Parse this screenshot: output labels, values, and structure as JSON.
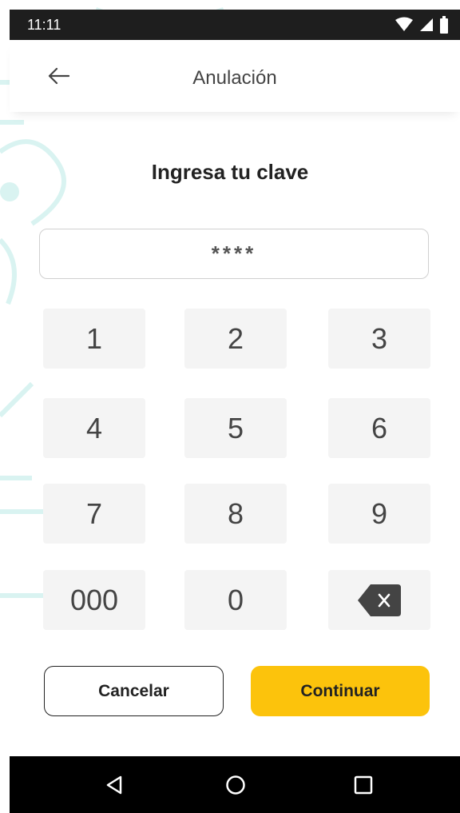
{
  "status_bar": {
    "time": "11:11",
    "icons": [
      "wifi-icon",
      "signal-icon",
      "battery-icon"
    ]
  },
  "app_bar": {
    "title": "Anulación",
    "back_icon": "arrow-left-icon"
  },
  "heading": "Ingresa tu clave",
  "pin_field": {
    "value": "****"
  },
  "keypad": {
    "keys": [
      "1",
      "2",
      "3",
      "4",
      "5",
      "6",
      "7",
      "8",
      "9",
      "000",
      "0"
    ],
    "delete_icon": "backspace-icon"
  },
  "actions": {
    "cancel_label": "Cancelar",
    "continue_label": "Continuar"
  },
  "nav_bar": {
    "icons": [
      "back-triangle-icon",
      "home-circle-icon",
      "recents-square-icon"
    ]
  },
  "colors": {
    "accent": "#fcc30c",
    "key_bg": "#f4f4f4",
    "status_bar": "#1e1e1e",
    "nav_bar": "#000000",
    "decoration": "#d9f3f1"
  }
}
